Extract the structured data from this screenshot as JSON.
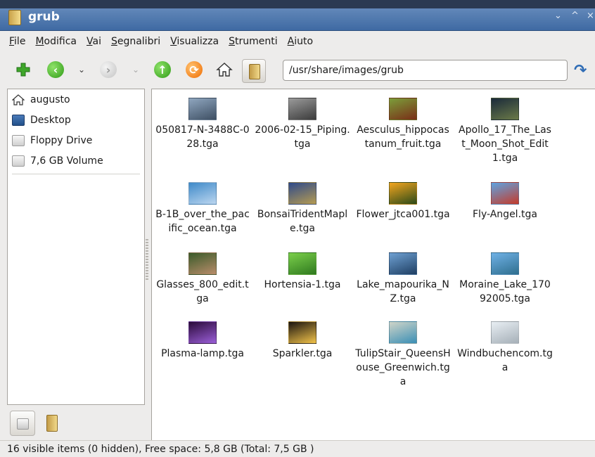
{
  "window": {
    "title": "grub",
    "minimize_glyph": "⌄",
    "maximize_glyph": "^",
    "close_glyph": "×"
  },
  "menu": [
    {
      "label": "File",
      "u": "F",
      "rest": "ile"
    },
    {
      "label": "Modifica",
      "u": "M",
      "rest": "odifica"
    },
    {
      "label": "Vai",
      "u": "V",
      "rest": "ai"
    },
    {
      "label": "Segnalibri",
      "u": "S",
      "rest": "egnalibri"
    },
    {
      "label": "Visualizza",
      "u": "V",
      "rest": "isualizza"
    },
    {
      "label": "Strumenti",
      "u": "S",
      "rest": "trumenti"
    },
    {
      "label": "Aiuto",
      "u": "A",
      "rest": "iuto"
    }
  ],
  "toolbar": {
    "icons": [
      "new-tab-plus-icon",
      "back-arrow-icon",
      "forward-arrow-icon",
      "up-arrow-icon",
      "reload-icon",
      "home-icon",
      "folder-icon"
    ],
    "address": "/usr/share/images/grub",
    "go_icon": "go-arrow-icon"
  },
  "sidebar": {
    "items": [
      {
        "label": "augusto",
        "icon": "home-icon"
      },
      {
        "label": "Desktop",
        "icon": "desktop-icon"
      },
      {
        "label": "Floppy Drive",
        "icon": "floppy-icon"
      },
      {
        "label": "7,6 GB Volume",
        "icon": "volume-icon"
      }
    ]
  },
  "files": [
    {
      "name": "050817-N-3488C-028.tga",
      "colors": [
        "#8fa6bf",
        "#3e4f63"
      ]
    },
    {
      "name": "2006-02-15_Piping.tga",
      "colors": [
        "#9a9a9a",
        "#3b3b3b"
      ]
    },
    {
      "name": "Aesculus_hippocastanum_fruit.tga",
      "colors": [
        "#7b9d3a",
        "#7a2e17"
      ]
    },
    {
      "name": "Apollo_17_The_Last_Moon_Shot_Edit1.tga",
      "colors": [
        "#1a2a3a",
        "#6b7a48"
      ]
    },
    {
      "name": "B-1B_over_the_pacific_ocean.tga",
      "colors": [
        "#3f8ac9",
        "#bcd6ef"
      ]
    },
    {
      "name": "BonsaiTridentMaple.tga",
      "colors": [
        "#2f4a8a",
        "#b59b52"
      ]
    },
    {
      "name": "Flower_jtca001.tga",
      "colors": [
        "#f2a51f",
        "#2b4a18"
      ]
    },
    {
      "name": "Fly-Angel.tga",
      "colors": [
        "#5fa3e0",
        "#c43b2b"
      ]
    },
    {
      "name": "Glasses_800_edit.tga",
      "colors": [
        "#3a5b2a",
        "#b98c6a"
      ]
    },
    {
      "name": "Hortensia-1.tga",
      "colors": [
        "#7bcf4b",
        "#2f7a1f"
      ]
    },
    {
      "name": "Lake_mapourika_NZ.tga",
      "colors": [
        "#6ea0d2",
        "#1f3f63"
      ]
    },
    {
      "name": "Moraine_Lake_17092005.tga",
      "colors": [
        "#6fb1e6",
        "#2f6f8f"
      ]
    },
    {
      "name": "Plasma-lamp.tga",
      "colors": [
        "#2b0a3a",
        "#9b5fd8"
      ]
    },
    {
      "name": "Sparkler.tga",
      "colors": [
        "#1a1410",
        "#f2c34a"
      ]
    },
    {
      "name": "TulipStair_QueensHouse_Greenwich.tga",
      "colors": [
        "#cfd4c8",
        "#3b8fb5"
      ]
    },
    {
      "name": "Windbuchencom.tga",
      "colors": [
        "#e8eef3",
        "#a6b0b8"
      ]
    }
  ],
  "status": "16 visible items (0 hidden), Free space: 5,8 GB (Total: 7,5 GB )"
}
